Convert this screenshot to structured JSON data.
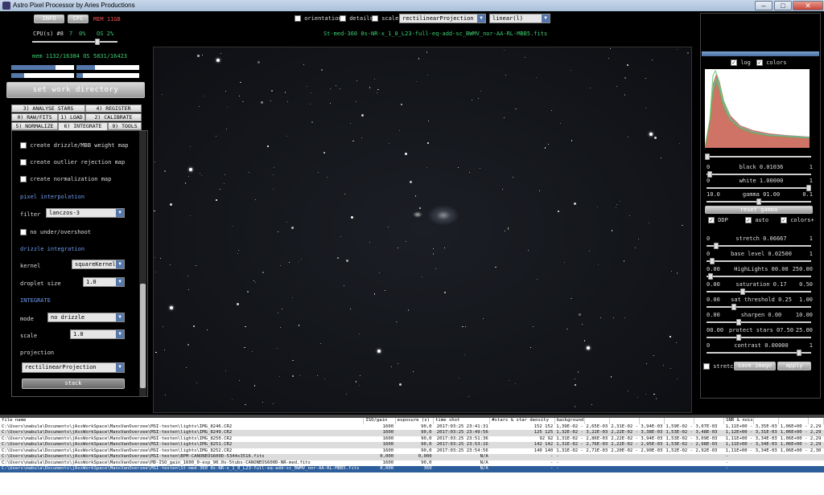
{
  "window": {
    "title": "Astro Pixel Processor by  Aries Productions",
    "minimize": "–",
    "maximize": "□",
    "close": "✕"
  },
  "top_left": {
    "info_button": "INFO",
    "cfc_button": "CFC",
    "memory_badge": "MEM 11GB",
    "cpu_label": "CPU(s) #8",
    "cpu_count": "7",
    "cpu_percent": "0%",
    "os_percent": "OS 2%",
    "cpu_slider_fraction": 0.78,
    "memory_stats": "mem 1132/16384  OS 5831/16423",
    "set_work_directory": "set work directory"
  },
  "tabs": {
    "row1": [
      "3) ANALYSE STARS",
      "4) REGISTER"
    ],
    "row2": [
      "0) RAW/FITS",
      "1) LOAD",
      "2) CALIBRATE"
    ],
    "row3": [
      "5) NORMALIZE",
      "6) INTEGRATE",
      "9) TOOLS"
    ]
  },
  "integrate_panel": {
    "drizzle_weight_map": "create drizzle/MBB weight map",
    "outlier_rejection_map": "create outlier rejection map",
    "normalization_map": "create normalization map",
    "pixel_interpolation_header": "pixel interpolation",
    "filter_label": "filter",
    "filter_value": "lanczos-3",
    "no_under_overshoot": "no under/overshoot",
    "drizzle_integration_header": "drizzle integration",
    "kernel_label": "kernel",
    "kernel_value": "squareKernel",
    "droplet_size_label": "droplet size",
    "droplet_size_value": "1.0",
    "integrate_header": "INTEGRATE",
    "mode_label": "mode",
    "mode_value": "no drizzle",
    "scale_label": "scale",
    "scale_value": "1.0",
    "projection_label": "projection",
    "projection_value": "rectilinearProjection",
    "stack_button": "stack"
  },
  "viewer_toolbar": {
    "orientation": "orientation",
    "details": "details",
    "scale": "scale",
    "projection_value": "rectilinearProjection",
    "stretch_mode_value": "linear(l)",
    "filename": "St-med-360 0s-NR-x_1_0_L23-full-eq-add-sc_BWMV_nor-AA-RL-MBB5.fits"
  },
  "histogram_panel": {
    "log": "log",
    "colors": "colors",
    "sliders": [
      {
        "min": "0",
        "name": "black 0.01036",
        "max": "1",
        "value": 0.01
      },
      {
        "min": "0",
        "name": "white 1.00000",
        "max": "1",
        "value": 1.0
      },
      {
        "min": "10.0",
        "name": "gamma 01.00",
        "max": "0.1",
        "value": 0.5
      }
    ],
    "reset_gamma": "reset gamma",
    "ddp": "DDP",
    "auto": "auto",
    "colors_plus": "colors+",
    "sliders2": [
      {
        "min": "0",
        "name": "stretch 0.06667",
        "max": "1",
        "value": 0.07
      },
      {
        "min": "0",
        "name": "base level 0.02500",
        "max": "1",
        "value": 0.03
      },
      {
        "min": "0.00",
        "name": "HighLights 00.00",
        "max": "250.00",
        "value": 0.02
      },
      {
        "min": "0.00",
        "name": "saturation 0.17",
        "max": "0.50",
        "value": 0.34
      },
      {
        "min": "0.00",
        "name": "sat threshold 0.25",
        "max": "1.00",
        "value": 0.25
      },
      {
        "min": "0.00",
        "name": "sharpen 0.00",
        "max": "10.00",
        "value": 0.3
      },
      {
        "min": "00.00",
        "name": "protect stars 07.50",
        "max": "25.00",
        "value": 0.3
      },
      {
        "min": "0",
        "name": "contrast 0.00000",
        "max": "1",
        "value": 0.9
      }
    ],
    "stretch": "stretch",
    "save_image": "save image",
    "apply": "apply"
  },
  "file_table": {
    "headers": [
      "file name",
      "ISO/gain",
      "exposure (s)",
      "time shot",
      "#stars & star density",
      "background & dispersion",
      "",
      "",
      "",
      "",
      "",
      "SNR & noise",
      "",
      "",
      ""
    ],
    "rows": [
      [
        "C:\\Users\\mabula\\Documents\\jAssWorkSpace\\MansVanOverzee\\MSI-testen\\lights\\IMG_8246.CR2",
        "1600",
        "90,0",
        "2017:03:25 23:41:31",
        "152 152",
        "1,39E-02 -",
        "2,65E-03",
        "2,31E-02 -",
        "3,94E-03",
        "1,59E-02 -",
        "3,07E-03",
        "1,11E+00 -",
        "3,35E-03",
        "1,06E+00 -",
        "2,29"
      ],
      [
        "C:\\Users\\mabula\\Documents\\jAssWorkSpace\\MansVanOverzee\\MSI-testen\\lights\\IMG_8249.CR2",
        "1600",
        "90,0",
        "2017:03:25 23:49:56",
        "125 125",
        "1,32E-02 -",
        "3,22E-03",
        "2,22E-02 -",
        "3,38E-03",
        "1,53E-02 -",
        "3,48E-03",
        "1,12E+00 -",
        "3,31E-03",
        "1,06E+00 -",
        "2,29"
      ],
      [
        "C:\\Users\\mabula\\Documents\\jAssWorkSpace\\MansVanOverzee\\MSI-testen\\lights\\IMG_8250.CR2",
        "1600",
        "90,0",
        "2017:03:25 23:51:36",
        "92 92",
        "1,31E-02 -",
        "2,86E-03",
        "2,22E-02 -",
        "3,94E-03",
        "1,53E-02 -",
        "3,09E-03",
        "1,11E+00 -",
        "3,34E-03",
        "1,06E+00 -",
        "2,29"
      ],
      [
        "C:\\Users\\mabula\\Documents\\jAssWorkSpace\\MansVanOverzee\\MSI-testen\\lights\\IMG_8251.CR2",
        "1600",
        "90,0",
        "2017:03:25 23:53:16",
        "142 142",
        "1,31E-02 -",
        "2,76E-03",
        "2,22E-02 -",
        "2,95E-03",
        "1,53E-02 -",
        "2,98E-03",
        "1,11E+00 -",
        "3,34E-03",
        "1,06E+00 -",
        "2,29"
      ],
      [
        "C:\\Users\\mabula\\Documents\\jAssWorkSpace\\MansVanOverzee\\MSI-testen\\lights\\IMG_8252.CR2",
        "1600",
        "90,0",
        "2017:03:25 23:54:56",
        "140 140",
        "1,31E-02 -",
        "2,71E-03",
        "2,20E-02 -",
        "2,90E-03",
        "1,52E-02 -",
        "2,92E-03",
        "1,11E+00 -",
        "3,34E-03",
        "1,06E+00 -",
        "2,30"
      ],
      [
        "C:\\Users\\mabula\\Documents\\jAssWorkSpace\\MansVanOverzee\\MSI-testen\\BPM-CANONEOS600D-5344x3516.fits",
        "0,000",
        "0,000",
        "N/A",
        "-",
        "-",
        "",
        "",
        "",
        "",
        "",
        "-",
        "",
        "",
        ""
      ],
      [
        "C:\\Users\\mabula\\Documents\\jAssWorkSpace\\MansVanOverzee\\MD-ISO_gain_1600_0-exp_90.0s-5tubs-CANONEOS600D-NR-med.fits",
        "1600",
        "90,0",
        "N/A",
        "-",
        "-",
        "",
        "",
        "",
        "",
        "",
        "-",
        "",
        "",
        ""
      ],
      [
        "C:\\Users\\mabula\\Documents\\jAssWorkSpace\\MansVanOverzee\\MSI-testen\\St-med-360 0s-NR-x_1_0_L23-full-eq-add-sc_BWMV_nor-AA-RL-MBB5.fits",
        "0,000",
        "360",
        "N/A",
        "-",
        "-",
        "",
        "",
        "",
        "",
        "",
        "-",
        "",
        "",
        ""
      ]
    ]
  },
  "colors": {
    "accent": "#3ecf70",
    "selection": "#2d5e9c",
    "panel_bg": "#000000"
  }
}
